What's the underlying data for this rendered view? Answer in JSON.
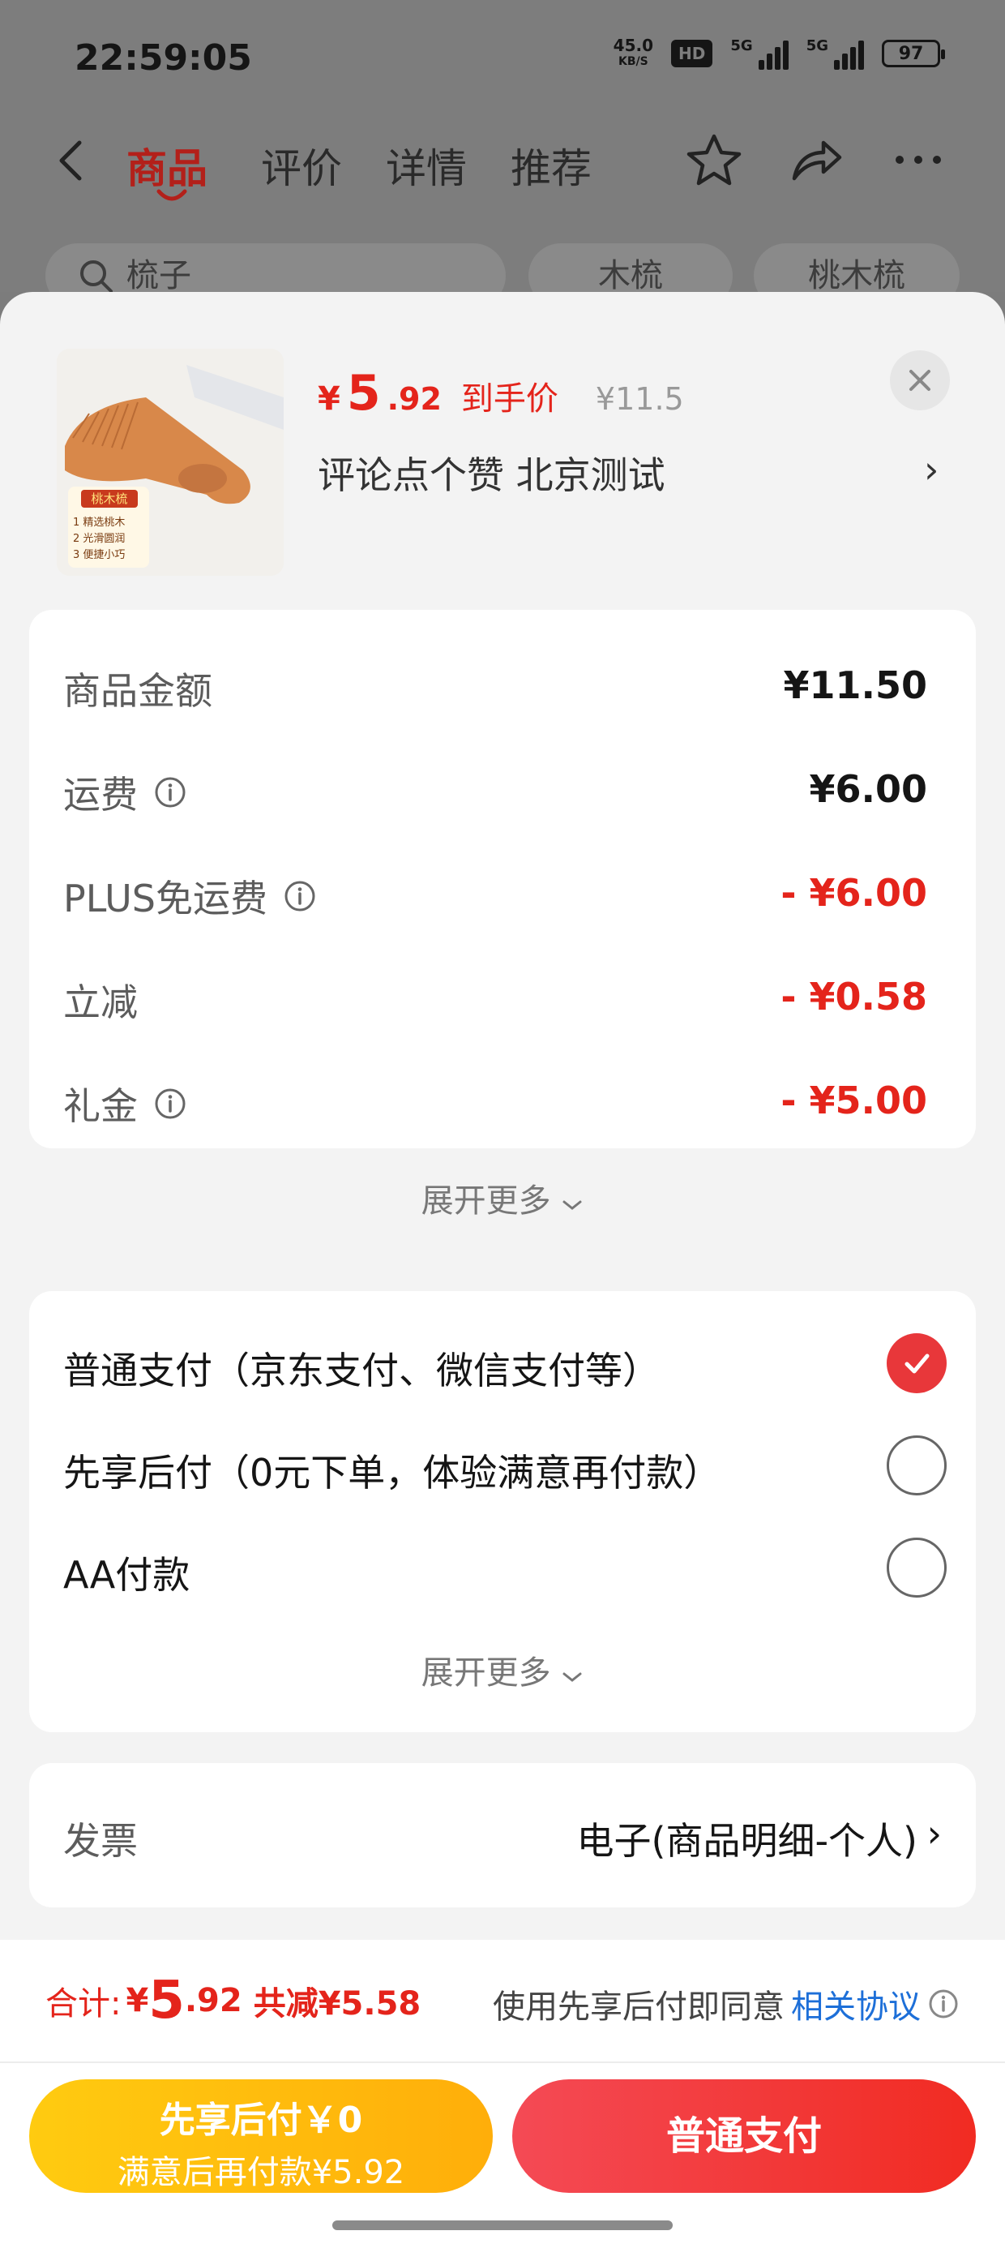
{
  "status_bar": {
    "time": "22:59:05",
    "net_speed_value": "45.0",
    "net_speed_unit": "KB/S",
    "hd_label": "HD",
    "signal1_label": "5G",
    "signal2_label": "5G",
    "battery": "97"
  },
  "nav": {
    "tabs": [
      {
        "label": "商品"
      },
      {
        "label": "评价"
      },
      {
        "label": "详情"
      },
      {
        "label": "推荐"
      }
    ],
    "active_color": "#b3201a"
  },
  "search_bg": {
    "chips": [
      {
        "label": "梳子"
      },
      {
        "label": "木梳"
      },
      {
        "label": "桃木梳"
      }
    ]
  },
  "product": {
    "price_currency": "¥",
    "price_integer": "5",
    "price_decimal": ".92",
    "price_tag": "到手价",
    "original_price": "¥11.5",
    "spec_text": "评论点个赞  北京测试",
    "thumb_badge": "桃木梳",
    "thumb_points": [
      "1 精选桃木",
      "2 光滑圆润",
      "3 便捷小巧"
    ]
  },
  "amounts": {
    "rows": [
      {
        "label": "商品金额",
        "value": "¥11.50"
      },
      {
        "label": "运费",
        "value": "¥6.00"
      },
      {
        "label": "PLUS免运费",
        "value": "- ¥6.00"
      },
      {
        "label": "立减",
        "value": "- ¥0.58"
      },
      {
        "label": "礼金",
        "value": "- ¥5.00"
      }
    ],
    "expand_label": "展开更多"
  },
  "payment": {
    "options": [
      {
        "label": "普通支付（京东支付、微信支付等）",
        "checked": true
      },
      {
        "label": "先享后付（0元下单，体验满意再付款）",
        "checked": false
      },
      {
        "label": "AA付款",
        "checked": false
      }
    ],
    "expand_label": "展开更多"
  },
  "invoice": {
    "label": "发票",
    "value": "电子(商品明细-个人)"
  },
  "footer": {
    "total_label": "合计:",
    "total_currency": "¥",
    "total_integer": "5",
    "total_decimal": ".92",
    "total_reduce": "共减¥5.58",
    "agree_prefix": "使用先享后付即同意",
    "agree_link": "相关协议",
    "btn_later_line1": "先享后付￥0",
    "btn_later_line2": "满意后再付款¥5.92",
    "btn_pay": "普通支付"
  },
  "colors": {
    "accent_red": "#e4241b",
    "link_blue": "#1d6fd8",
    "later_yellow": "#ffbd0e",
    "pay_red": "#f23a3c"
  }
}
